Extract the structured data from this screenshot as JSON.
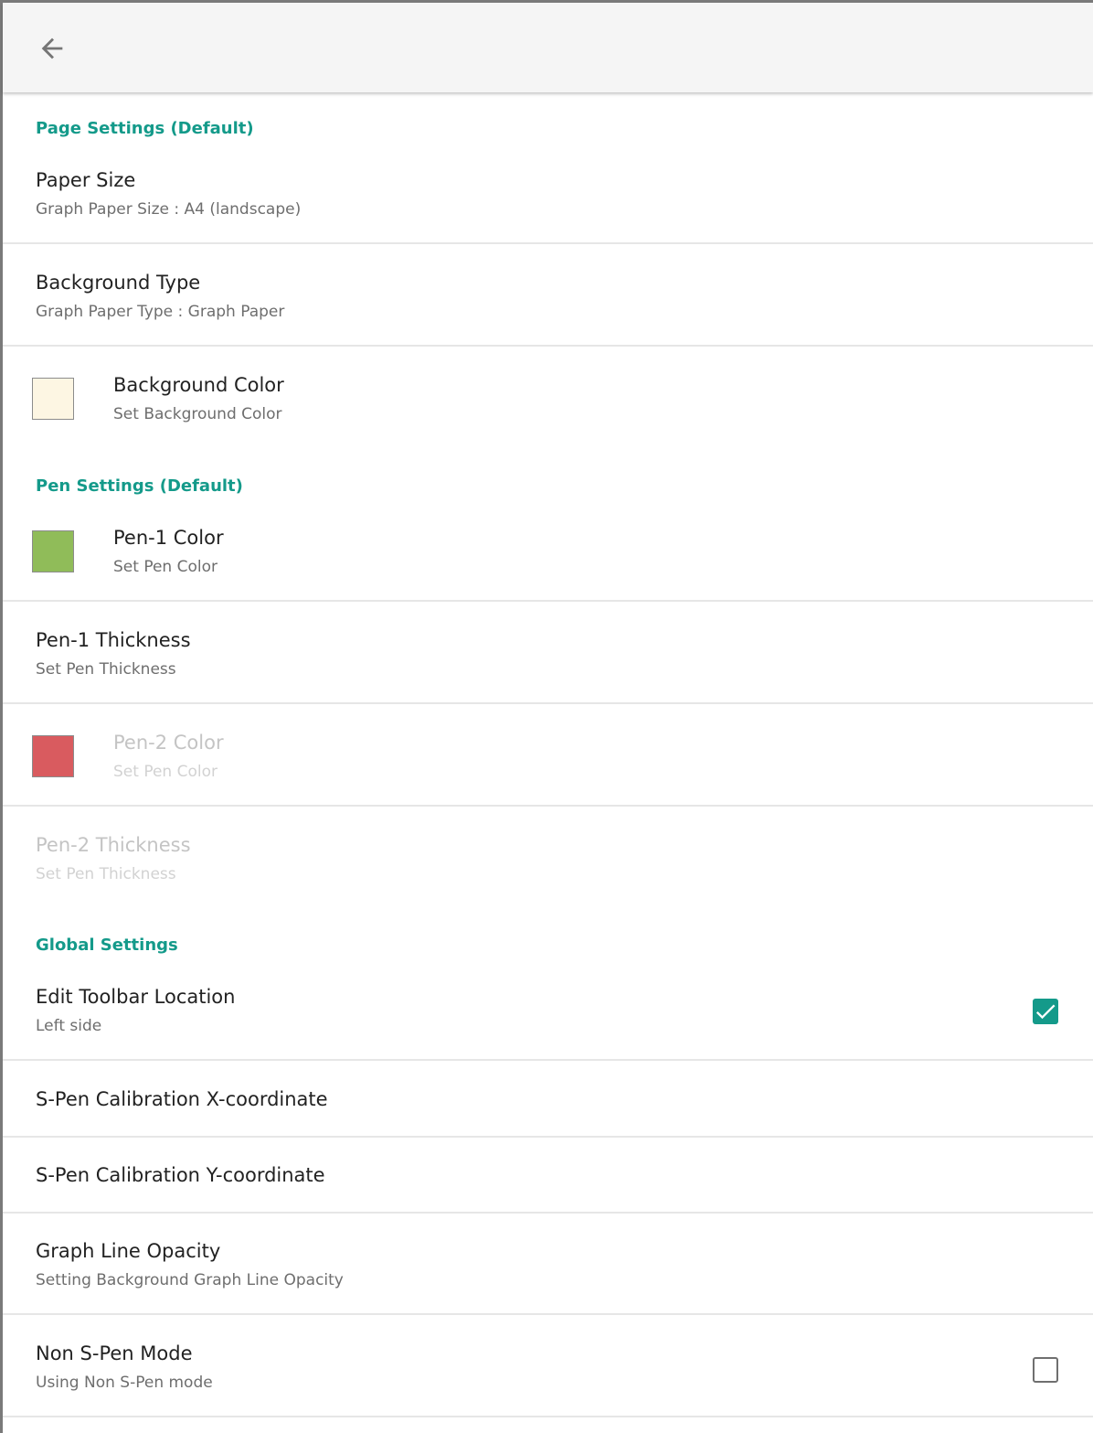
{
  "colors": {
    "accent": "#149a8a",
    "background_color_swatch": "#fdf6e3",
    "pen1_color_swatch": "#90bc59",
    "pen2_color_swatch": "#d95b5f"
  },
  "appbar": {
    "back_icon": "arrow-back-icon"
  },
  "sections": {
    "page": "Page Settings (Default)",
    "pen": "Pen Settings (Default)",
    "global": "Global Settings"
  },
  "prefs": {
    "paper_size": {
      "title": "Paper Size",
      "summary": "Graph Paper Size : A4 (landscape)"
    },
    "background_type": {
      "title": "Background Type",
      "summary": "Graph Paper Type : Graph Paper"
    },
    "background_color": {
      "title": "Background Color",
      "summary": "Set Background Color"
    },
    "pen1_color": {
      "title": "Pen-1 Color",
      "summary": "Set Pen Color"
    },
    "pen1_thickness": {
      "title": "Pen-1 Thickness",
      "summary": "Set Pen Thickness"
    },
    "pen2_color": {
      "title": "Pen-2 Color",
      "summary": "Set Pen Color",
      "enabled": false
    },
    "pen2_thickness": {
      "title": "Pen-2 Thickness",
      "summary": "Set Pen Thickness",
      "enabled": false
    },
    "edit_toolbar_location": {
      "title": "Edit Toolbar Location",
      "summary": "Left side",
      "checked": true
    },
    "spen_calibration_x": {
      "title": "S-Pen Calibration X-coordinate"
    },
    "spen_calibration_y": {
      "title": "S-Pen Calibration Y-coordinate"
    },
    "graph_line_opacity": {
      "title": "Graph Line Opacity",
      "summary": "Setting Background Graph Line Opacity"
    },
    "non_spen_mode": {
      "title": "Non S-Pen Mode",
      "summary": "Using Non S-Pen mode",
      "checked": false
    }
  }
}
